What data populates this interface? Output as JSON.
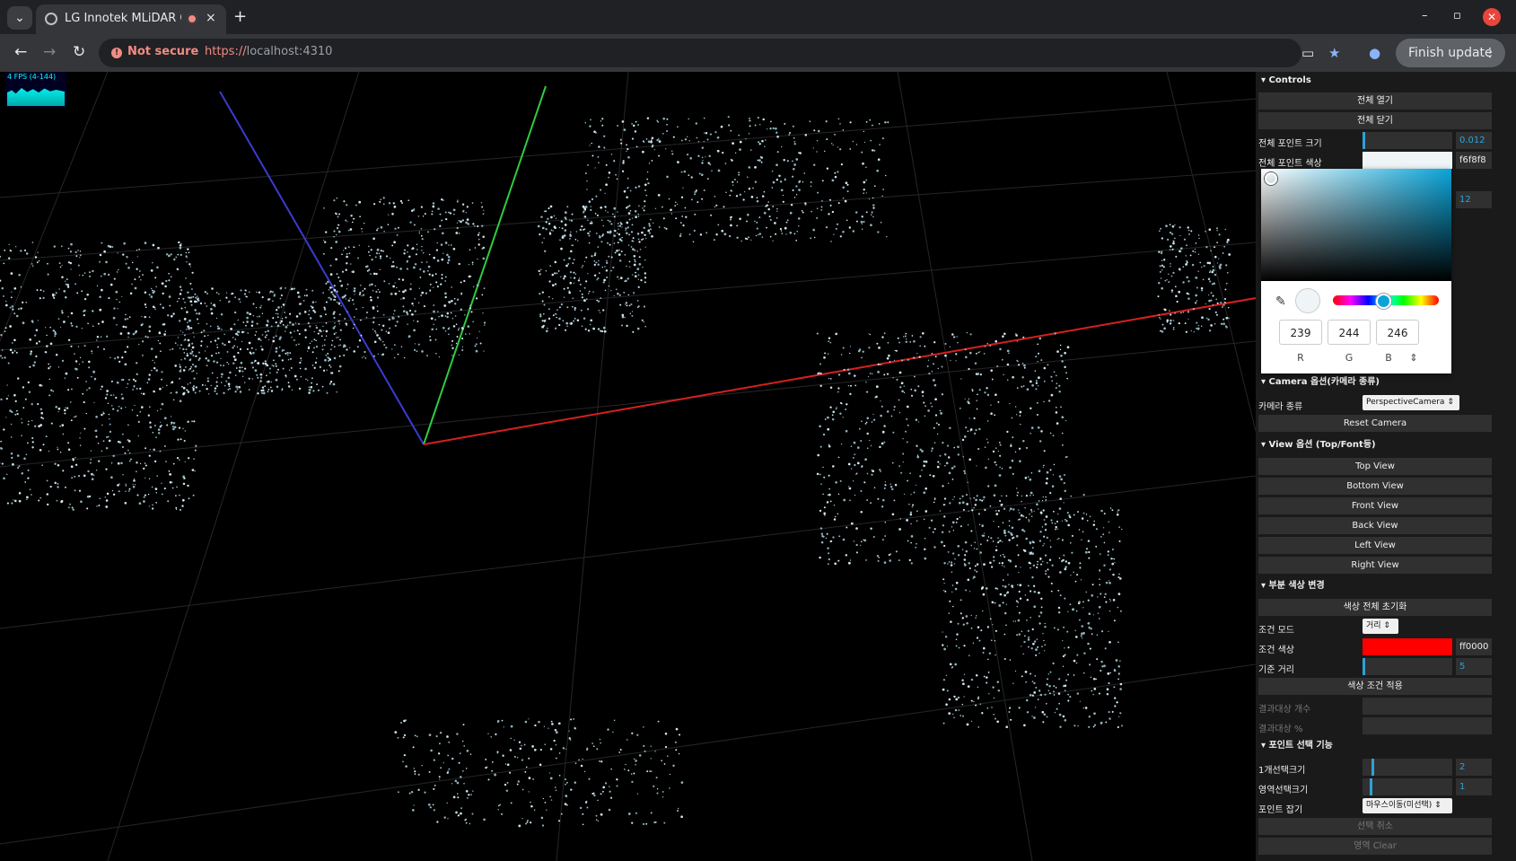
{
  "browser": {
    "tab_title": "LG Innotek MLiDAR C",
    "tab_close": "×",
    "new_tab": "+",
    "not_secure": "Not secure",
    "url_scheme": "https://",
    "url_host": "localhost:4310",
    "finish_update": "Finish update",
    "icons": [
      "tab-search-icon",
      "favicon-icon",
      "recording-icon",
      "back-icon",
      "forward-icon",
      "reload-icon",
      "camera-icon",
      "bookmark-star-icon",
      "profile-icon",
      "menu-icon"
    ]
  },
  "fps": {
    "label": "4 FPS (4-144)"
  },
  "controls": {
    "header": "Controls",
    "open_all": "전체 열기",
    "close_all": "전체 닫기",
    "point_size_label": "전체 포인트 크기",
    "point_size_value": "0.012",
    "point_color_label": "전체 포인트 색상",
    "point_color_value": "f6f8f8",
    "hidden_value": "12"
  },
  "picker": {
    "r": "239",
    "g": "244",
    "b": "246",
    "r_lbl": "R",
    "g_lbl": "G",
    "b_lbl": "B",
    "mode_toggle": "⇕"
  },
  "camera": {
    "header": "Camera 옵션(카메라 종류)",
    "type_label": "카메라 종류",
    "type_value": "PerspectiveCamera",
    "reset": "Reset Camera"
  },
  "view": {
    "header": "View 옵션 (Top/Font등)",
    "buttons": [
      "Top View",
      "Bottom View",
      "Front View",
      "Back View",
      "Left View",
      "Right View"
    ]
  },
  "partial_color": {
    "header": "부분 색상 변경",
    "reset_all": "색상 전체 초기화",
    "mode_label": "조건 모드",
    "mode_value": "거리",
    "color_label": "조건 색상",
    "color_value": "ff0000",
    "distance_label": "기준 거리",
    "distance_value": "5",
    "apply": "색상 조건 적용",
    "result_count": "결과대상 개수",
    "result_pct": "결과대상 %"
  },
  "point_select": {
    "header": "포인트 선택 기능",
    "single_size_label": "1개선택크기",
    "single_size_value": "2",
    "area_size_label": "영역선택크기",
    "area_size_value": "1",
    "pick_label": "포인트 잡기",
    "pick_value": "마우스이동(미선택)",
    "cancel": "선택 취소",
    "area_clear": "영역 Clear"
  },
  "colors": {
    "accent": "#2fa1d6",
    "condition_color": "#ff0000",
    "point_color": "#eff4f6"
  }
}
